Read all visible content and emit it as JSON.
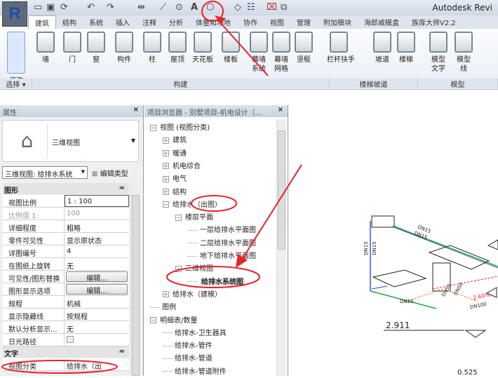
{
  "app": {
    "title": "Autodesk Revi",
    "logo": "R"
  },
  "quick_access": [
    "open-icon",
    "save-icon",
    "sync-icon",
    "undo-icon",
    "redo-icon",
    "measure-icon",
    "dimension-icon",
    "tag-icon",
    "text-icon",
    "3d-view-icon",
    "section-icon",
    "thin-lines-icon",
    "close-hidden-icon",
    "switch-windows-icon"
  ],
  "quick_access_text": {
    "text_tool": "A"
  },
  "tabs": [
    "建筑",
    "结构",
    "系统",
    "插入",
    "注释",
    "分析",
    "体量和场地",
    "协作",
    "视图",
    "管理",
    "附加模块",
    "海郎威模盒",
    "族库大师V2.2"
  ],
  "ribbon": {
    "tools": [
      {
        "label": "修改"
      },
      {
        "label": "墙"
      },
      {
        "label": "门"
      },
      {
        "label": "窗"
      },
      {
        "label": "构件"
      },
      {
        "label": "柱"
      },
      {
        "label": "屋顶"
      },
      {
        "label": "天花板"
      },
      {
        "label": "楼板"
      },
      {
        "label": "幕墙\n系统"
      },
      {
        "label": "幕墙\n网格"
      },
      {
        "label": "竖梃"
      },
      {
        "label": "栏杆扶手"
      },
      {
        "label": "坡道"
      },
      {
        "label": "楼梯"
      },
      {
        "label": "模型\n文字"
      },
      {
        "label": "模型\n线"
      }
    ],
    "panels": [
      "选择 ▾",
      "构建",
      "楼梯坡道",
      "模型"
    ]
  },
  "properties": {
    "title": "属性",
    "close": "×",
    "type_name": "三维视图",
    "selector": "三维视图: 给排水系统",
    "edit_type": "编辑类型",
    "groups": [
      {
        "name": "图形",
        "rows": [
          {
            "k": "视图比例",
            "v": "1 : 100"
          },
          {
            "k": "比例值 1:",
            "v": "100"
          },
          {
            "k": "详细程度",
            "v": "粗略"
          },
          {
            "k": "零件可见性",
            "v": "显示原状态"
          },
          {
            "k": "详图编号",
            "v": "4"
          },
          {
            "k": "在图纸上旋转",
            "v": "无"
          },
          {
            "k": "可见性/图形替换",
            "v": "编辑..."
          },
          {
            "k": "图形显示选项",
            "v": "编辑..."
          },
          {
            "k": "规程",
            "v": "机械"
          },
          {
            "k": "显示隐藏线",
            "v": "按规程"
          },
          {
            "k": "默认分析显示...",
            "v": "无"
          },
          {
            "k": "日光路径",
            "v": ""
          }
        ]
      },
      {
        "name": "文字",
        "rows": [
          {
            "k": "视图分类",
            "v": "给排水（出"
          }
        ]
      }
    ],
    "sun_path_checked": false
  },
  "browser": {
    "title": "项目浏览器 - 别墅项目-机电设计（...",
    "close": "×",
    "nodes": [
      {
        "t": "视图 (视图分类)",
        "lvl": 0,
        "pm": "−"
      },
      {
        "t": "建筑",
        "lvl": 1,
        "pm": "+"
      },
      {
        "t": "暖通",
        "lvl": 1,
        "pm": "+"
      },
      {
        "t": "机电综合",
        "lvl": 1,
        "pm": "+"
      },
      {
        "t": "电气",
        "lvl": 1,
        "pm": "+"
      },
      {
        "t": "结构",
        "lvl": 1,
        "pm": "+"
      },
      {
        "t": "给排水（出图）",
        "lvl": 1,
        "pm": "−"
      },
      {
        "t": "楼层平面",
        "lvl": 2,
        "pm": "−"
      },
      {
        "t": "一层给排水平面图",
        "lvl": 3,
        "pm": ""
      },
      {
        "t": "二层给排水平面图",
        "lvl": 3,
        "pm": ""
      },
      {
        "t": "地下给排水平面图",
        "lvl": 3,
        "pm": ""
      },
      {
        "t": "三维视图",
        "lvl": 2,
        "pm": "−"
      },
      {
        "t": "给排水系统图",
        "lvl": 3,
        "pm": "",
        "bold": true
      },
      {
        "t": "给排水（建模）",
        "lvl": 1,
        "pm": "+"
      },
      {
        "t": "图例",
        "lvl": 0,
        "pm": ""
      },
      {
        "t": "明细表/数量",
        "lvl": 0,
        "pm": "−"
      },
      {
        "t": "给排水-卫生器具",
        "lvl": 1,
        "pm": ""
      },
      {
        "t": "给排水-管件",
        "lvl": 1,
        "pm": ""
      },
      {
        "t": "给排水-管道",
        "lvl": 1,
        "pm": ""
      },
      {
        "t": "给排水-管道附件",
        "lvl": 1,
        "pm": ""
      }
    ]
  },
  "drawing": {
    "labels": [
      "DN15",
      "DN15",
      "DN15",
      "DN15",
      "DN20",
      "DN50",
      "DN50",
      "2.60%",
      "DN100",
      "2.911",
      "0.525"
    ]
  },
  "colors": {
    "annotation": "#e8222a",
    "accent": "#1e4fa8"
  }
}
